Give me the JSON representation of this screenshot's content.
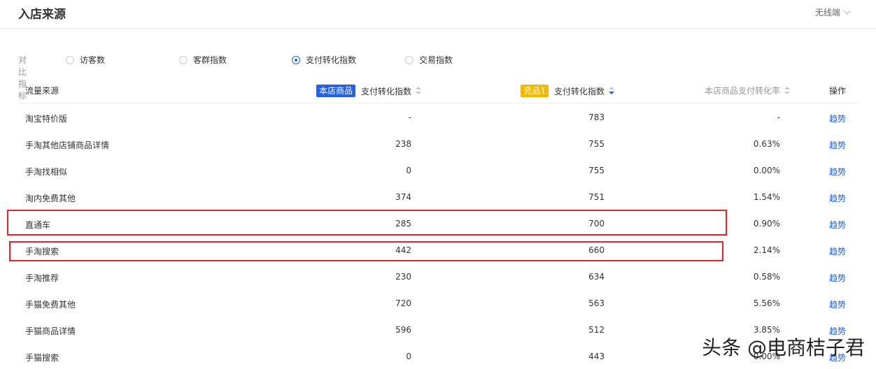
{
  "header": {
    "title": "入店来源",
    "device_selector": "无线端"
  },
  "metrics": {
    "label": "对比指标",
    "options": [
      {
        "label": "访客数",
        "selected": false
      },
      {
        "label": "客群指数",
        "selected": false
      },
      {
        "label": "支付转化指数",
        "selected": true
      },
      {
        "label": "交易指数",
        "selected": false
      }
    ]
  },
  "table": {
    "headers": {
      "source": "流量来源",
      "own_badge": "本店商品",
      "own_metric": "支付转化指数",
      "comp_badge": "竞品1",
      "comp_metric": "支付转化指数",
      "rate": "本店商品支付转化率",
      "action": "操作"
    },
    "rows": [
      {
        "source": "淘宝特价版",
        "own": "-",
        "comp": "783",
        "rate": "-",
        "action": "趋势"
      },
      {
        "source": "手淘其他店铺商品详情",
        "own": "238",
        "comp": "755",
        "rate": "0.63%",
        "action": "趋势"
      },
      {
        "source": "手淘找相似",
        "own": "0",
        "comp": "755",
        "rate": "0.00%",
        "action": "趋势"
      },
      {
        "source": "淘内免费其他",
        "own": "374",
        "comp": "751",
        "rate": "1.54%",
        "action": "趋势"
      },
      {
        "source": "直通车",
        "own": "285",
        "comp": "700",
        "rate": "0.90%",
        "action": "趋势"
      },
      {
        "source": "手淘搜索",
        "own": "442",
        "comp": "660",
        "rate": "2.14%",
        "action": "趋势"
      },
      {
        "source": "手淘推荐",
        "own": "230",
        "comp": "634",
        "rate": "0.58%",
        "action": "趋势"
      },
      {
        "source": "手猫免费其他",
        "own": "720",
        "comp": "563",
        "rate": "5.56%",
        "action": "趋势"
      },
      {
        "source": "手猫商品详情",
        "own": "596",
        "comp": "512",
        "rate": "3.85%",
        "action": "趋势"
      },
      {
        "source": "手猫搜索",
        "own": "0",
        "comp": "443",
        "rate": "0.00%",
        "action": "趋势"
      }
    ]
  },
  "watermark": "头条 @电商桔子君",
  "colors": {
    "accent": "#2062e6",
    "own_badge": "#2062e6",
    "comp_badge": "#f5b800",
    "highlight": "#e6252a"
  }
}
